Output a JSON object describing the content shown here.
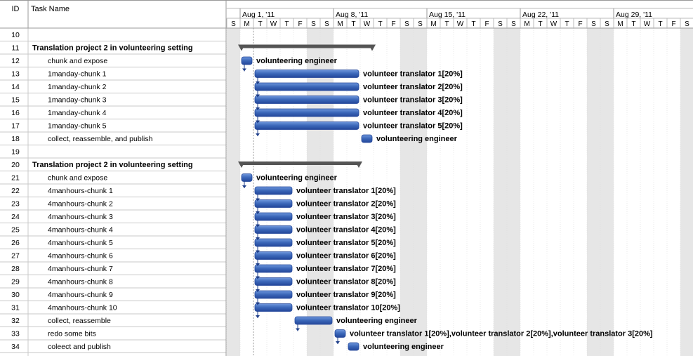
{
  "header": {
    "id_label": "ID",
    "task_label": "Task Name",
    "weeks": [
      "Aug 1, '11",
      "Aug 8, '11",
      "Aug 15, '11",
      "Aug 22, '11",
      "Aug 29, '11"
    ],
    "day_letters": [
      "S",
      "M",
      "T",
      "W",
      "T",
      "F",
      "S",
      "S",
      "M",
      "T",
      "W",
      "T",
      "F",
      "S",
      "S",
      "M",
      "T",
      "W",
      "T",
      "F",
      "S",
      "S",
      "M",
      "T",
      "W",
      "T",
      "F",
      "S",
      "S",
      "M",
      "T",
      "W",
      "T",
      "F",
      "S"
    ]
  },
  "colors": {
    "bar": "#3a66b8",
    "bar_dark": "#24479a",
    "summary": "#555555",
    "weekend_shade": "#e6e6e6",
    "grid_line": "#c8c8c8"
  },
  "rows": [
    {
      "id": "10",
      "name": "",
      "level": 0,
      "bar": null,
      "label": ""
    },
    {
      "id": "11",
      "name": "Translation project 2 in volunteering setting",
      "level": 0,
      "bold": true,
      "summary": {
        "start": 1,
        "end": 11
      },
      "label": ""
    },
    {
      "id": "12",
      "name": "chunk and expose",
      "level": 1,
      "bar": {
        "start": 1,
        "end": 2
      },
      "label": "volunteering engineer"
    },
    {
      "id": "13",
      "name": "1manday-chunk 1",
      "level": 1,
      "bar": {
        "start": 2,
        "end": 10
      },
      "label": "volunteer translator 1[20%]"
    },
    {
      "id": "14",
      "name": "1manday-chunk 2",
      "level": 1,
      "bar": {
        "start": 2,
        "end": 10
      },
      "label": "volunteer translator 2[20%]"
    },
    {
      "id": "15",
      "name": "1manday-chunk 3",
      "level": 1,
      "bar": {
        "start": 2,
        "end": 10
      },
      "label": "volunteer translator 3[20%]"
    },
    {
      "id": "16",
      "name": "1manday-chunk 4",
      "level": 1,
      "bar": {
        "start": 2,
        "end": 10
      },
      "label": "volunteer translator 4[20%]"
    },
    {
      "id": "17",
      "name": "1manday-chunk 5",
      "level": 1,
      "bar": {
        "start": 2,
        "end": 10
      },
      "label": "volunteer translator 5[20%]"
    },
    {
      "id": "18",
      "name": "collect, reassemble, and publish",
      "level": 1,
      "bar": {
        "start": 10,
        "end": 11
      },
      "label": "volunteering engineer"
    },
    {
      "id": "19",
      "name": "",
      "level": 0,
      "bar": null,
      "label": ""
    },
    {
      "id": "20",
      "name": "Translation project 2 in volunteering setting",
      "level": 0,
      "bold": true,
      "summary": {
        "start": 1,
        "end": 10
      },
      "label": ""
    },
    {
      "id": "21",
      "name": "chunk and expose",
      "level": 1,
      "bar": {
        "start": 1,
        "end": 2
      },
      "label": "volunteering engineer"
    },
    {
      "id": "22",
      "name": "4manhours-chunk 1",
      "level": 1,
      "bar": {
        "start": 2,
        "end": 5
      },
      "label": "volunteer translator 1[20%]"
    },
    {
      "id": "23",
      "name": "4manhours-chunk 2",
      "level": 1,
      "bar": {
        "start": 2,
        "end": 5
      },
      "label": "volunteer translator 2[20%]"
    },
    {
      "id": "24",
      "name": "4manhours-chunk 3",
      "level": 1,
      "bar": {
        "start": 2,
        "end": 5
      },
      "label": "volunteer translator 3[20%]"
    },
    {
      "id": "25",
      "name": "4manhours-chunk 4",
      "level": 1,
      "bar": {
        "start": 2,
        "end": 5
      },
      "label": "volunteer translator 4[20%]"
    },
    {
      "id": "26",
      "name": "4manhours-chunk 5",
      "level": 1,
      "bar": {
        "start": 2,
        "end": 5
      },
      "label": "volunteer translator 5[20%]"
    },
    {
      "id": "27",
      "name": "4manhours-chunk 6",
      "level": 1,
      "bar": {
        "start": 2,
        "end": 5
      },
      "label": "volunteer translator 6[20%]"
    },
    {
      "id": "28",
      "name": "4manhours-chunk 7",
      "level": 1,
      "bar": {
        "start": 2,
        "end": 5
      },
      "label": "volunteer translator 7[20%]"
    },
    {
      "id": "29",
      "name": "4manhours-chunk 8",
      "level": 1,
      "bar": {
        "start": 2,
        "end": 5
      },
      "label": "volunteer translator 8[20%]"
    },
    {
      "id": "30",
      "name": "4manhours-chunk 9",
      "level": 1,
      "bar": {
        "start": 2,
        "end": 5
      },
      "label": "volunteer translator 9[20%]"
    },
    {
      "id": "31",
      "name": "4manhours-chunk 10",
      "level": 1,
      "bar": {
        "start": 2,
        "end": 5
      },
      "label": "volunteer translator 10[20%]"
    },
    {
      "id": "32",
      "name": "collect, reassemble",
      "level": 1,
      "bar": {
        "start": 5,
        "end": 8
      },
      "label": "volunteering engineer"
    },
    {
      "id": "33",
      "name": "redo some bits",
      "level": 1,
      "bar": {
        "start": 8,
        "end": 9
      },
      "label": "volunteer translator 1[20%],volunteer translator 2[20%],volunteer translator 3[20%]"
    },
    {
      "id": "34",
      "name": "coleect and publish",
      "level": 1,
      "bar": {
        "start": 9,
        "end": 10
      },
      "label": "volunteering engineer"
    }
  ]
}
